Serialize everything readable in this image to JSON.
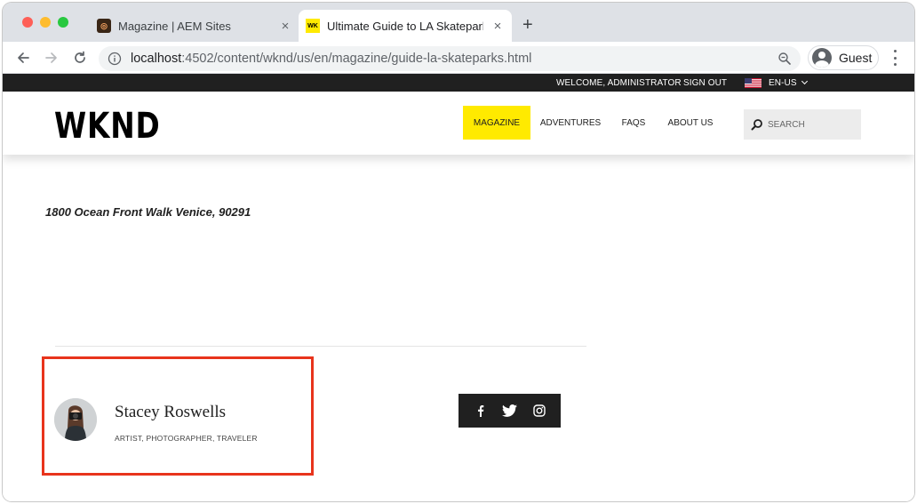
{
  "browser": {
    "tabs": [
      {
        "title": "Magazine | AEM Sites",
        "favicon": "aem-icon",
        "active": false
      },
      {
        "title": "Ultimate Guide to LA Skateparks",
        "favicon": "wknd-icon",
        "favicon_text": "WK",
        "active": true
      }
    ],
    "new_tab_label": "+",
    "close_label": "×",
    "url_host": "localhost",
    "url_rest": ":4502/content/wknd/us/en/magazine/guide-la-skateparks.html",
    "profile_label": "Guest"
  },
  "utility_bar": {
    "welcome": "WELCOME, ADMINISTRATOR",
    "sign_out": "SIGN OUT",
    "language": "EN-US"
  },
  "site": {
    "logo": "WKND",
    "nav": [
      {
        "label": "MAGAZINE",
        "active": true
      },
      {
        "label": "ADVENTURES",
        "active": false
      },
      {
        "label": "FAQS",
        "active": false
      },
      {
        "label": "ABOUT US",
        "active": false
      }
    ],
    "search_placeholder": "SEARCH"
  },
  "content": {
    "address": "1800 Ocean Front Walk Venice, 90291"
  },
  "author": {
    "name": "Stacey Roswells",
    "title": "ARTIST, PHOTOGRAPHER, TRAVELER"
  },
  "social": [
    "facebook-icon",
    "twitter-icon",
    "instagram-icon"
  ],
  "colors": {
    "accent": "#ffea00",
    "highlight_border": "#e8341c",
    "utility_bar_bg": "#202020"
  }
}
